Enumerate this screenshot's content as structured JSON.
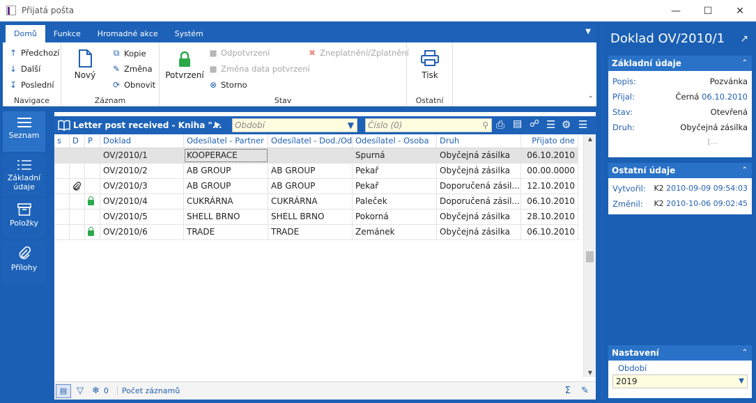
{
  "window": {
    "title": "Přijatá pošta",
    "logo_text": "K2"
  },
  "ribbon": {
    "tabs": [
      "Domů",
      "Funkce",
      "Hromadné akce",
      "Systém"
    ],
    "navigace": {
      "label": "Navigace",
      "items": [
        "Předchozí",
        "Další",
        "Poslední"
      ]
    },
    "zaznam": {
      "label": "Záznam",
      "new": "Nový",
      "items": [
        "Kopie",
        "Změna",
        "Obnovit"
      ]
    },
    "stav": {
      "label": "Stav",
      "confirm": "Potvrzení",
      "items": [
        "Odpotvrzení",
        "Změna data potvrzení",
        "Storno"
      ],
      "invalidate": "Zneplatnění/Zplatnění"
    },
    "ostatni": {
      "label": "Ostatní",
      "print": "Tisk"
    }
  },
  "leftnav": [
    "Seznam",
    "Základní údaje",
    "Položky",
    "Přílohy"
  ],
  "grid": {
    "title": "Letter post received - Kniha \"...",
    "period_placeholder": "Období",
    "number_placeholder": "Číslo (0)",
    "columns": [
      "s",
      "D",
      "P",
      "Doklad",
      "Odesílatel - Partner",
      "Odesílatel - Dod./Odb",
      "Odesílatel - Osoba",
      "Druh",
      "Přijato dne"
    ],
    "rows": [
      {
        "d": "",
        "p": "",
        "doklad": "OV/2010/1",
        "partner": "KOOPERACE",
        "dododb": "",
        "osoba": "Spurná",
        "druh": "Obyčejná zásilka",
        "date": "06.10.2010"
      },
      {
        "d": "",
        "p": "",
        "doklad": "OV/2010/2",
        "partner": "AB GROUP",
        "dododb": "AB GROUP",
        "osoba": "Pekař",
        "druh": "Obyčejná zásilka",
        "date": "00.00.0000"
      },
      {
        "d": "clip",
        "p": "",
        "doklad": "OV/2010/3",
        "partner": "AB GROUP",
        "dododb": "AB GROUP",
        "osoba": "Pekař",
        "druh": "Doporučená zásil...",
        "date": "12.10.2010"
      },
      {
        "d": "",
        "p": "lock",
        "doklad": "OV/2010/4",
        "partner": "CUKRÁRNA",
        "dododb": "CUKRÁRNA",
        "osoba": "Paleček",
        "druh": "Doporučená zásil...",
        "date": "06.10.2010"
      },
      {
        "d": "",
        "p": "",
        "doklad": "OV/2010/5",
        "partner": "SHELL BRNO",
        "dododb": "SHELL BRNO",
        "osoba": "Pokorná",
        "druh": "Obyčejná zásilka",
        "date": "28.10.2010"
      },
      {
        "d": "",
        "p": "lock",
        "doklad": "OV/2010/6",
        "partner": "TRADE",
        "dododb": "TRADE",
        "osoba": "Zemánek",
        "druh": "Obyčejná zásilka",
        "date": "06.10.2010"
      }
    ],
    "footer": {
      "count": "0",
      "label": "Počet záznamů"
    }
  },
  "rpanel": {
    "title": "Doklad OV/2010/1",
    "zakladni": {
      "header": "Základní údaje",
      "popis_label": "Popis:",
      "popis": "Pozvánka",
      "prijal_label": "Přijal:",
      "prijal_name": "Černá",
      "prijal_date": "06.10.2010",
      "stav_label": "Stav:",
      "stav": "Otevřená",
      "druh_label": "Druh:",
      "druh": "Obyčejná zásilka",
      "more": "[..."
    },
    "ostatni": {
      "header": "Ostatní údaje",
      "vytvoril_label": "Vytvořil:",
      "vytvoril_user": "K2",
      "vytvoril_time": "2010-09-09 09:54:03",
      "zmenil_label": "Změnil:",
      "zmenil_user": "K2",
      "zmenil_time": "2010-10-06 09:02:45"
    },
    "nastaveni": {
      "header": "Nastavení",
      "obdobi_label": "Období",
      "obdobi": "2019"
    }
  }
}
